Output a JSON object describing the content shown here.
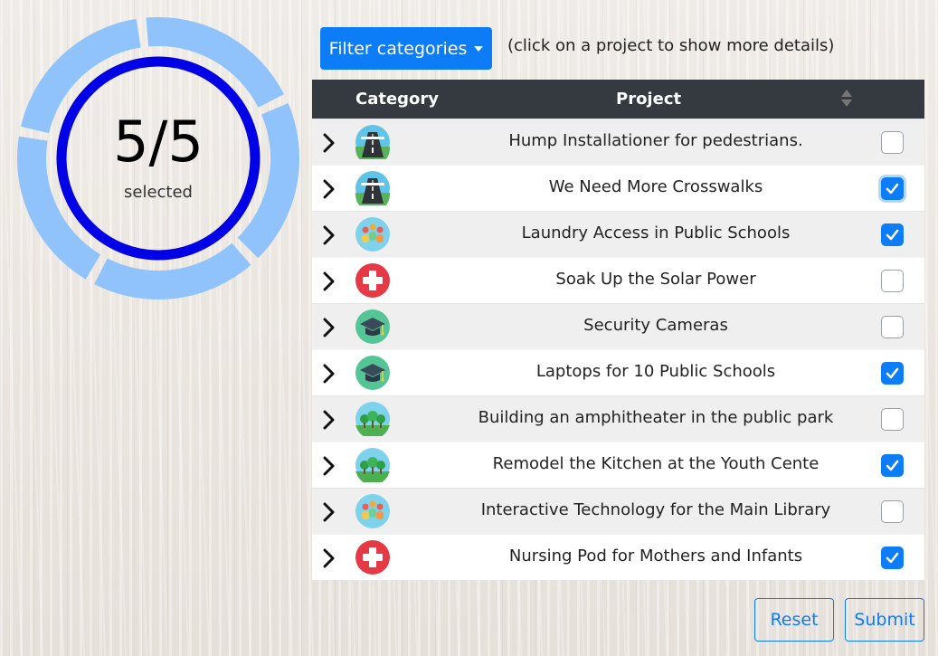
{
  "progress": {
    "count_text": "5/5",
    "label": "selected",
    "selected": 5,
    "total": 5,
    "ring_color": "#0000e6",
    "segment_color": "#90c3fb"
  },
  "toolbar": {
    "filter_label": "Filter categories",
    "hint": "(click on a project to show more details)"
  },
  "table": {
    "headers": {
      "category": "Category",
      "project": "Project"
    },
    "rows": [
      {
        "icon": "road-icon",
        "project": "Hump Installationer for pedestrians.",
        "checked": false
      },
      {
        "icon": "road-icon",
        "project": "We Need More Crosswalks",
        "checked": true
      },
      {
        "icon": "people-icon",
        "project": "Laundry Access in Public Schools",
        "checked": true
      },
      {
        "icon": "health-cross-icon",
        "project": "Soak Up the Solar Power",
        "checked": false
      },
      {
        "icon": "graduation-cap-icon",
        "project": "Security Cameras",
        "checked": false
      },
      {
        "icon": "graduation-cap-icon",
        "project": "Laptops for 10 Public Schools",
        "checked": true
      },
      {
        "icon": "park-trees-icon",
        "project": "Building an amphitheater in the public park",
        "checked": false
      },
      {
        "icon": "park-trees-icon",
        "project": "Remodel the Kitchen at the Youth Cente",
        "checked": true
      },
      {
        "icon": "people-icon",
        "project": "Interactive Technology for the Main Library",
        "checked": false
      },
      {
        "icon": "health-cross-icon",
        "project": "Nursing Pod for Mothers and Infants",
        "checked": true
      }
    ]
  },
  "actions": {
    "reset_label": "Reset",
    "submit_label": "Submit"
  },
  "colors": {
    "accent": "#0d7cf7",
    "header_bg": "#343a40"
  }
}
